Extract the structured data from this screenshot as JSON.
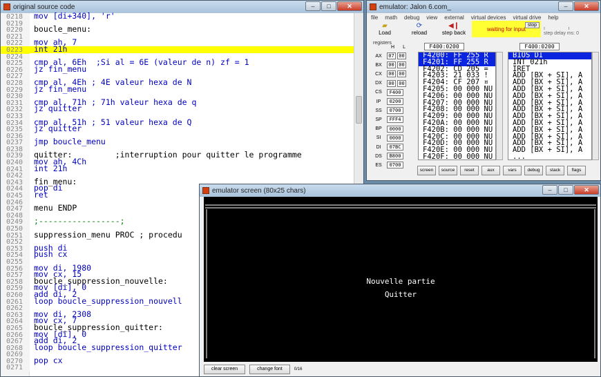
{
  "source_window": {
    "title": "original source code",
    "lines": [
      {
        "no": "0218",
        "text": "mov [di+340], 'r'"
      },
      {
        "no": "0219",
        "text": ""
      },
      {
        "no": "0220",
        "text": "boucle_menu:"
      },
      {
        "no": "0221",
        "text": ""
      },
      {
        "no": "0222",
        "text": "mov ah, 7"
      },
      {
        "no": "0223",
        "text": "int 21h"
      },
      {
        "no": "0224",
        "text": ""
      },
      {
        "no": "0225",
        "text": "cmp al, 6Eh  ;Si al = 6E (valeur de n) zf = 1"
      },
      {
        "no": "0226",
        "text": "jz fin_menu"
      },
      {
        "no": "0227",
        "text": ""
      },
      {
        "no": "0228",
        "text": "cmp al, 4Eh ; 4E valeur hexa de N"
      },
      {
        "no": "0229",
        "text": "jz fin_menu"
      },
      {
        "no": "0230",
        "text": ""
      },
      {
        "no": "0231",
        "text": "cmp al, 71h ; 71h valeur hexa de q"
      },
      {
        "no": "0232",
        "text": "jz quitter"
      },
      {
        "no": "0233",
        "text": ""
      },
      {
        "no": "0234",
        "text": "cmp al, 51h ; 51 valeur hexa de Q"
      },
      {
        "no": "0235",
        "text": "jz quitter"
      },
      {
        "no": "0236",
        "text": ""
      },
      {
        "no": "0237",
        "text": "jmp boucle_menu"
      },
      {
        "no": "0238",
        "text": ""
      },
      {
        "no": "0239",
        "text": "quitter:         ;interruption pour quitter le programme"
      },
      {
        "no": "0240",
        "text": "mov ah, 4Ch"
      },
      {
        "no": "0241",
        "text": "int 21h"
      },
      {
        "no": "0242",
        "text": ""
      },
      {
        "no": "0243",
        "text": "fin_menu:"
      },
      {
        "no": "0244",
        "text": "pop di"
      },
      {
        "no": "0245",
        "text": "ret"
      },
      {
        "no": "0246",
        "text": ""
      },
      {
        "no": "0247",
        "text": "menu ENDP"
      },
      {
        "no": "0248",
        "text": ""
      },
      {
        "no": "0249",
        "text": ";-----------------;"
      },
      {
        "no": "0250",
        "text": ""
      },
      {
        "no": "0251",
        "text": "suppression_menu PROC ; procedu"
      },
      {
        "no": "0252",
        "text": ""
      },
      {
        "no": "0253",
        "text": "push di"
      },
      {
        "no": "0254",
        "text": "push cx"
      },
      {
        "no": "0255",
        "text": ""
      },
      {
        "no": "0256",
        "text": "mov di, 1980"
      },
      {
        "no": "0257",
        "text": "mov cx, 15"
      },
      {
        "no": "0258",
        "text": "boucle_suppression_nouvelle:"
      },
      {
        "no": "0259",
        "text": "mov [di], 0"
      },
      {
        "no": "0260",
        "text": "add di, 2"
      },
      {
        "no": "0261",
        "text": "loop boucle_suppression_nouvell"
      },
      {
        "no": "0262",
        "text": ""
      },
      {
        "no": "0263",
        "text": "mov di, 2308"
      },
      {
        "no": "0264",
        "text": "mov cx, 7"
      },
      {
        "no": "0265",
        "text": "boucle_suppression_quitter:"
      },
      {
        "no": "0266",
        "text": "mov [di], 0"
      },
      {
        "no": "0267",
        "text": "add di, 2"
      },
      {
        "no": "0268",
        "text": "loop boucle_suppression_quitter"
      },
      {
        "no": "0269",
        "text": ""
      },
      {
        "no": "0270",
        "text": "pop cx"
      },
      {
        "no": "0271",
        "text": ""
      }
    ],
    "highlighted_line": "0223"
  },
  "emulator_window": {
    "title": "emulator: Jalon 6.com_",
    "menu": [
      "file",
      "math",
      "debug",
      "view",
      "external",
      "virtual devices",
      "virtual drive",
      "help"
    ],
    "toolbar": {
      "load": "Load",
      "reload": "reload",
      "step_back": "step back",
      "status": "waiting for input",
      "stop": "stop",
      "step_delay": "step delay ms: 0"
    },
    "registers_label": "registers",
    "col_h": "H",
    "col_l": "L",
    "registers": [
      {
        "name": "AX",
        "h": "07",
        "l": "00"
      },
      {
        "name": "BX",
        "h": "00",
        "l": "00"
      },
      {
        "name": "CX",
        "h": "00",
        "l": "00"
      },
      {
        "name": "DX",
        "h": "00",
        "l": "00"
      },
      {
        "name": "CS",
        "v": "F400"
      },
      {
        "name": "IP",
        "v": "0200"
      },
      {
        "name": "SS",
        "v": "0700"
      },
      {
        "name": "SP",
        "v": "FFF4"
      },
      {
        "name": "BP",
        "v": "0000"
      },
      {
        "name": "SI",
        "v": "0000"
      },
      {
        "name": "DI",
        "v": "07BC"
      },
      {
        "name": "DS",
        "v": "B800"
      },
      {
        "name": "ES",
        "v": "0700"
      }
    ],
    "mem_addr": "F400:0200",
    "dis_addr": "F400:0200",
    "memory": [
      "F4200: FF 255 R",
      "F4201: FF 255 R",
      "F4202: CD 205 =",
      "F4203: 21 033 !",
      "F4204: CF 207 ¤",
      "F4205: 00 000 NU",
      "F4206: 00 000 NU",
      "F4207: 00 000 NU",
      "F4208: 00 000 NU",
      "F4209: 00 000 NU",
      "F420A: 00 000 NU",
      "F420B: 00 000 NU",
      "F420C: 00 000 NU",
      "F420D: 00 000 NU",
      "F420E: 00 000 NU",
      "F420F: 00 000 NU"
    ],
    "disassembly": [
      "BIOS DI",
      "INT 021h",
      "IRET",
      "ADD [BX + SI], A",
      "ADD [BX + SI], A",
      "ADD [BX + SI], A",
      "ADD [BX + SI], A",
      "ADD [BX + SI], A",
      "ADD [BX + SI], A",
      "ADD [BX + SI], A",
      "ADD [BX + SI], A",
      "ADD [BX + SI], A",
      "ADD [BX + SI], A",
      "ADD [BX + SI], A",
      "ADD [BX + SI], A",
      "..."
    ],
    "bottom_buttons": [
      "screen",
      "source",
      "reset",
      "aux",
      "vars",
      "debug",
      "stack",
      "flags"
    ]
  },
  "screen_window": {
    "title": "emulator screen (80x25 chars)",
    "menu_line1": "Nouvelle partie",
    "menu_line2": "Quitter",
    "clear_screen": "clear screen",
    "change_font": "change font",
    "small_label": "0/16"
  }
}
